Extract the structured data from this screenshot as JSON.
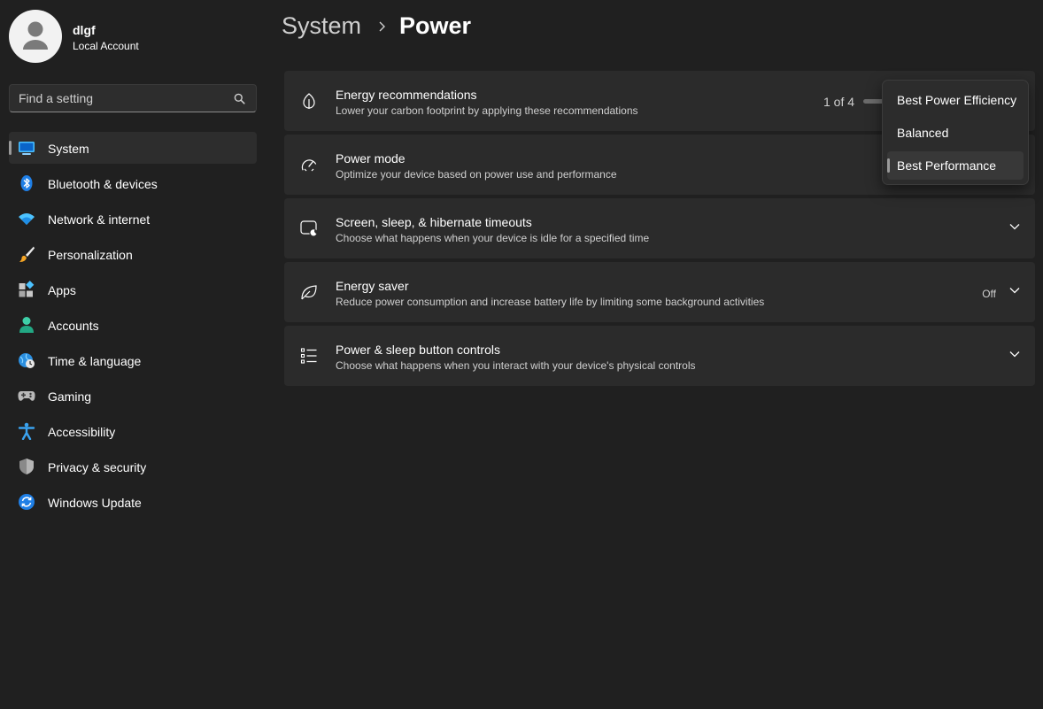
{
  "profile": {
    "name": "dlgf",
    "account_type": "Local Account"
  },
  "search": {
    "placeholder": "Find a setting",
    "icon": "search-icon"
  },
  "sidebar": {
    "items": [
      {
        "label": "System",
        "icon": "system-display-icon",
        "selected": true
      },
      {
        "label": "Bluetooth & devices",
        "icon": "bluetooth-icon"
      },
      {
        "label": "Network & internet",
        "icon": "wifi-icon"
      },
      {
        "label": "Personalization",
        "icon": "paintbrush-icon"
      },
      {
        "label": "Apps",
        "icon": "apps-grid-icon"
      },
      {
        "label": "Accounts",
        "icon": "person-icon"
      },
      {
        "label": "Time & language",
        "icon": "globe-clock-icon"
      },
      {
        "label": "Gaming",
        "icon": "gamepad-icon"
      },
      {
        "label": "Accessibility",
        "icon": "accessibility-icon"
      },
      {
        "label": "Privacy & security",
        "icon": "shield-icon"
      },
      {
        "label": "Windows Update",
        "icon": "update-icon"
      }
    ]
  },
  "breadcrumb": {
    "parent": "System",
    "current": "Power"
  },
  "cards": [
    {
      "title": "Energy recommendations",
      "description": "Lower your carbon footprint by applying these recommendations",
      "icon": "leaf-icon",
      "count_text": "1 of 4"
    },
    {
      "title": "Power mode",
      "description": "Optimize your device based on power use and performance",
      "icon": "speedometer-icon"
    },
    {
      "title": "Screen, sleep, & hibernate timeouts",
      "description": "Choose what happens when your device is idle for a specified time",
      "icon": "screen-sleep-icon"
    },
    {
      "title": "Energy saver",
      "description": "Reduce power consumption and increase battery life by limiting some background activities",
      "icon": "energy-saver-leaf-icon",
      "status": "Off"
    },
    {
      "title": "Power & sleep button controls",
      "description": "Choose what happens when you interact with your device's physical controls",
      "icon": "list-icon"
    }
  ],
  "power_mode_dropdown": {
    "options": [
      "Best Power Efficiency",
      "Balanced",
      "Best Performance"
    ],
    "selected": "Best Performance"
  },
  "colors": {
    "background": "#202020",
    "card": "#2b2b2b",
    "accent": "#4cc2ff"
  }
}
